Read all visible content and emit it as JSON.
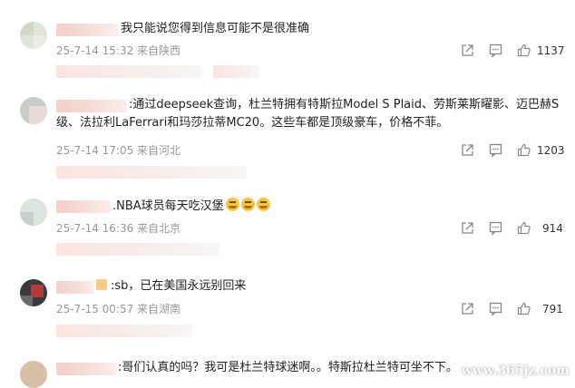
{
  "comments": [
    {
      "text": "我只能说您得到信息可能不是很准确",
      "meta": "25-7-14 15:32 来自陕西",
      "likes": "1137"
    },
    {
      "text": ":通过deepseek查询，杜兰特拥有特斯拉Model S Plaid、劳斯莱斯曜影、迈巴赫S级、法拉利LaFerrari和玛莎拉蒂MC20。这些车都是顶级豪车，价格不菲。",
      "meta": "25-7-14 17:05 来自河北",
      "likes": "1203"
    },
    {
      "text": ".NBA球员每天吃汉堡",
      "meta": "25-7-14 16:36 来自北京",
      "likes": "914"
    },
    {
      "text": ":sb，已在美国永远别回来",
      "meta": "25-7-15 00:57 来自湖南",
      "likes": "791"
    },
    {
      "text": ":哥们认真的吗？我可是杜兰特球迷啊。。特斯拉杜兰特可坐不下。"
    }
  ],
  "icons": {
    "share": "share-icon",
    "comment": "comment-icon",
    "like": "thumbs-up-icon"
  },
  "watermark": "www.365jz.com"
}
